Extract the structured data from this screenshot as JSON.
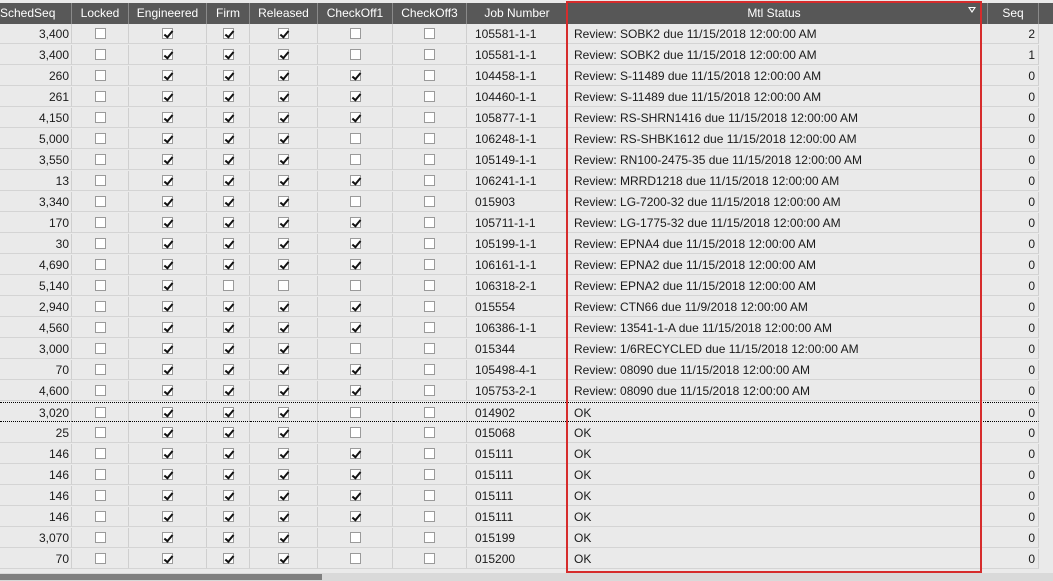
{
  "columns": {
    "sched_seq": "SchedSeq",
    "locked": "Locked",
    "engineered": "Engineered",
    "firm": "Firm",
    "released": "Released",
    "checkoff1": "CheckOff1",
    "checkoff3": "CheckOff3",
    "job_number": "Job Number",
    "mtl_status": "Mtl Status",
    "seq": "Seq"
  },
  "icons": {
    "filter": "filter-icon"
  },
  "colors": {
    "highlight_border": "#d62c2c",
    "header_bg": "#585858",
    "grid_bg": "#eaeaea"
  },
  "rows": [
    {
      "sched": "3,400",
      "locked": false,
      "eng": true,
      "firm": true,
      "rel": true,
      "ck1": false,
      "ck3": false,
      "job": "105581-1-1",
      "mtl": "Review: SOBK2 due 11/15/2018 12:00:00 AM",
      "seq": "2"
    },
    {
      "sched": "3,400",
      "locked": false,
      "eng": true,
      "firm": true,
      "rel": true,
      "ck1": false,
      "ck3": false,
      "job": "105581-1-1",
      "mtl": "Review: SOBK2 due 11/15/2018 12:00:00 AM",
      "seq": "1"
    },
    {
      "sched": "260",
      "locked": false,
      "eng": true,
      "firm": true,
      "rel": true,
      "ck1": true,
      "ck3": false,
      "job": "104458-1-1",
      "mtl": "Review: S-11489 due 11/15/2018 12:00:00 AM",
      "seq": "0"
    },
    {
      "sched": "261",
      "locked": false,
      "eng": true,
      "firm": true,
      "rel": true,
      "ck1": true,
      "ck3": false,
      "job": "104460-1-1",
      "mtl": "Review: S-11489 due 11/15/2018 12:00:00 AM",
      "seq": "0"
    },
    {
      "sched": "4,150",
      "locked": false,
      "eng": true,
      "firm": true,
      "rel": true,
      "ck1": true,
      "ck3": false,
      "job": "105877-1-1",
      "mtl": "Review: RS-SHRN1416 due 11/15/2018 12:00:00 AM",
      "seq": "0"
    },
    {
      "sched": "5,000",
      "locked": false,
      "eng": true,
      "firm": true,
      "rel": true,
      "ck1": false,
      "ck3": false,
      "job": "106248-1-1",
      "mtl": "Review: RS-SHBK1612 due 11/15/2018 12:00:00 AM",
      "seq": "0"
    },
    {
      "sched": "3,550",
      "locked": false,
      "eng": true,
      "firm": true,
      "rel": true,
      "ck1": false,
      "ck3": false,
      "job": "105149-1-1",
      "mtl": "Review: RN100-2475-35 due 11/15/2018 12:00:00 AM",
      "seq": "0"
    },
    {
      "sched": "13",
      "locked": false,
      "eng": true,
      "firm": true,
      "rel": true,
      "ck1": true,
      "ck3": false,
      "job": "106241-1-1",
      "mtl": "Review: MRRD1218 due 11/15/2018 12:00:00 AM",
      "seq": "0"
    },
    {
      "sched": "3,340",
      "locked": false,
      "eng": true,
      "firm": true,
      "rel": true,
      "ck1": false,
      "ck3": false,
      "job": "015903",
      "mtl": "Review: LG-7200-32 due 11/15/2018 12:00:00 AM",
      "seq": "0"
    },
    {
      "sched": "170",
      "locked": false,
      "eng": true,
      "firm": true,
      "rel": true,
      "ck1": true,
      "ck3": false,
      "job": "105711-1-1",
      "mtl": "Review: LG-1775-32 due 11/15/2018 12:00:00 AM",
      "seq": "0"
    },
    {
      "sched": "30",
      "locked": false,
      "eng": true,
      "firm": true,
      "rel": true,
      "ck1": true,
      "ck3": false,
      "job": "105199-1-1",
      "mtl": "Review: EPNA4 due 11/15/2018 12:00:00 AM",
      "seq": "0"
    },
    {
      "sched": "4,690",
      "locked": false,
      "eng": true,
      "firm": true,
      "rel": true,
      "ck1": true,
      "ck3": false,
      "job": "106161-1-1",
      "mtl": "Review: EPNA2 due 11/15/2018 12:00:00 AM",
      "seq": "0"
    },
    {
      "sched": "5,140",
      "locked": false,
      "eng": true,
      "firm": false,
      "rel": false,
      "ck1": false,
      "ck3": false,
      "job": "106318-2-1",
      "mtl": "Review: EPNA2 due 11/15/2018 12:00:00 AM",
      "seq": "0"
    },
    {
      "sched": "2,940",
      "locked": false,
      "eng": true,
      "firm": true,
      "rel": true,
      "ck1": true,
      "ck3": false,
      "job": "015554",
      "mtl": "Review: CTN66 due 11/9/2018 12:00:00 AM",
      "seq": "0"
    },
    {
      "sched": "4,560",
      "locked": false,
      "eng": true,
      "firm": true,
      "rel": true,
      "ck1": true,
      "ck3": false,
      "job": "106386-1-1",
      "mtl": "Review: 13541-1-A due 11/15/2018 12:00:00 AM",
      "seq": "0"
    },
    {
      "sched": "3,000",
      "locked": false,
      "eng": true,
      "firm": true,
      "rel": true,
      "ck1": false,
      "ck3": false,
      "job": "015344",
      "mtl": "Review: 1/6RECYCLED due 11/15/2018 12:00:00 AM",
      "seq": "0"
    },
    {
      "sched": "70",
      "locked": false,
      "eng": true,
      "firm": true,
      "rel": true,
      "ck1": true,
      "ck3": false,
      "job": "105498-4-1",
      "mtl": "Review: 08090 due 11/15/2018 12:00:00 AM",
      "seq": "0"
    },
    {
      "sched": "4,600",
      "locked": false,
      "eng": true,
      "firm": true,
      "rel": true,
      "ck1": true,
      "ck3": false,
      "job": "105753-2-1",
      "mtl": "Review: 08090 due 11/15/2018 12:00:00 AM",
      "seq": "0"
    },
    {
      "sched": "3,020",
      "locked": false,
      "eng": true,
      "firm": true,
      "rel": true,
      "ck1": false,
      "ck3": false,
      "job": "014902",
      "mtl": "OK",
      "seq": "0",
      "focused": true
    },
    {
      "sched": "25",
      "locked": false,
      "eng": true,
      "firm": true,
      "rel": true,
      "ck1": false,
      "ck3": false,
      "job": "015068",
      "mtl": "OK",
      "seq": "0"
    },
    {
      "sched": "146",
      "locked": false,
      "eng": true,
      "firm": true,
      "rel": true,
      "ck1": true,
      "ck3": false,
      "job": "015111",
      "mtl": "OK",
      "seq": "0"
    },
    {
      "sched": "146",
      "locked": false,
      "eng": true,
      "firm": true,
      "rel": true,
      "ck1": true,
      "ck3": false,
      "job": "015111",
      "mtl": "OK",
      "seq": "0"
    },
    {
      "sched": "146",
      "locked": false,
      "eng": true,
      "firm": true,
      "rel": true,
      "ck1": true,
      "ck3": false,
      "job": "015111",
      "mtl": "OK",
      "seq": "0"
    },
    {
      "sched": "146",
      "locked": false,
      "eng": true,
      "firm": true,
      "rel": true,
      "ck1": true,
      "ck3": false,
      "job": "015111",
      "mtl": "OK",
      "seq": "0"
    },
    {
      "sched": "3,070",
      "locked": false,
      "eng": true,
      "firm": true,
      "rel": true,
      "ck1": false,
      "ck3": false,
      "job": "015199",
      "mtl": "OK",
      "seq": "0"
    },
    {
      "sched": "70",
      "locked": false,
      "eng": true,
      "firm": true,
      "rel": true,
      "ck1": false,
      "ck3": false,
      "job": "015200",
      "mtl": "OK",
      "seq": "0"
    }
  ]
}
